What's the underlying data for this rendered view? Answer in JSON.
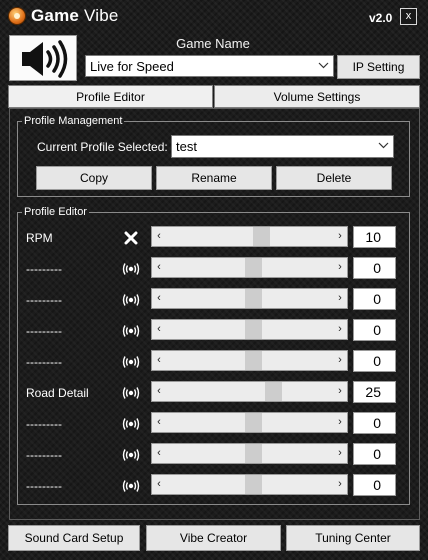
{
  "header": {
    "title_part1": "Game",
    "title_part2": "Vibe",
    "version": "v2.0",
    "close_label": "x"
  },
  "game": {
    "label": "Game Name",
    "selected": "Live for Speed",
    "ip_button": "IP Setting"
  },
  "tabs": [
    {
      "label": "Profile Editor",
      "active": true
    },
    {
      "label": "Volume Settings",
      "active": false
    }
  ],
  "profile_management": {
    "title": "Profile Management",
    "current_label": "Current Profile Selected:",
    "current_value": "test",
    "buttons": {
      "copy": "Copy",
      "rename": "Rename",
      "delete": "Delete"
    }
  },
  "profile_editor": {
    "title": "Profile Editor",
    "rows": [
      {
        "label": "RPM",
        "icon": "close-icon",
        "value": "10",
        "level": 10
      },
      {
        "label": "---------",
        "icon": "vibration-icon",
        "value": "0",
        "level": 0
      },
      {
        "label": "---------",
        "icon": "vibration-icon",
        "value": "0",
        "level": 0
      },
      {
        "label": "---------",
        "icon": "vibration-icon",
        "value": "0",
        "level": 0
      },
      {
        "label": "---------",
        "icon": "vibration-icon",
        "value": "0",
        "level": 0
      },
      {
        "label": "Road Detail",
        "icon": "vibration-icon",
        "value": "25",
        "level": 25
      },
      {
        "label": "---------",
        "icon": "vibration-icon",
        "value": "0",
        "level": 0
      },
      {
        "label": "---------",
        "icon": "vibration-icon",
        "value": "0",
        "level": 0
      },
      {
        "label": "---------",
        "icon": "vibration-icon",
        "value": "0",
        "level": 0
      }
    ]
  },
  "footer": {
    "sound_card": "Sound Card Setup",
    "vibe_creator": "Vibe Creator",
    "tuning_center": "Tuning Center"
  },
  "colors": {
    "background": "#1c1c1c",
    "button_face": "#e6e6e6",
    "slider_thumb": "#cdcdcd"
  }
}
